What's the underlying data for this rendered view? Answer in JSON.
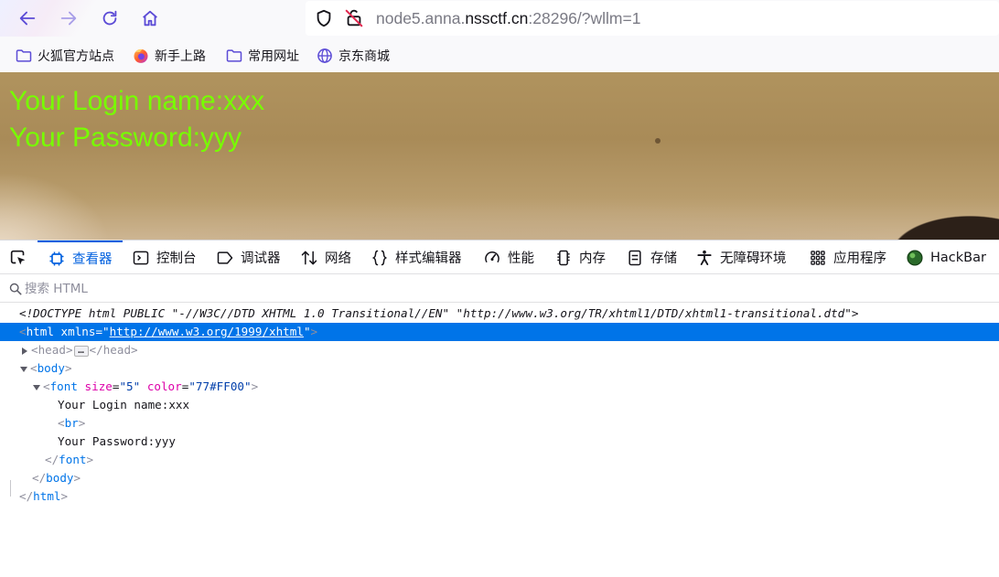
{
  "browser": {
    "url": {
      "prefix": "node5.anna.",
      "host": "nssctf.cn",
      "suffix": ":28296/?wllm=1"
    }
  },
  "bookmarks": [
    {
      "label": "火狐官方站点",
      "icon": "folder-icon"
    },
    {
      "label": "新手上路",
      "icon": "firefox-icon"
    },
    {
      "label": "常用网址",
      "icon": "folder-icon"
    },
    {
      "label": "京东商城",
      "icon": "globe-icon"
    }
  ],
  "page": {
    "login_line": "Your Login name:xxx",
    "password_line": "Your Password:yyy",
    "text_color": "#77ff00"
  },
  "devtools": {
    "tabs": [
      {
        "label": "查看器",
        "icon": "inspector-icon",
        "active": true
      },
      {
        "label": "控制台",
        "icon": "console-icon"
      },
      {
        "label": "调试器",
        "icon": "debugger-icon"
      },
      {
        "label": "网络",
        "icon": "network-icon"
      },
      {
        "label": "样式编辑器",
        "icon": "style-editor-icon"
      },
      {
        "label": "性能",
        "icon": "performance-icon"
      },
      {
        "label": "内存",
        "icon": "memory-icon"
      },
      {
        "label": "存储",
        "icon": "storage-icon"
      },
      {
        "label": "无障碍环境",
        "icon": "accessibility-icon"
      },
      {
        "label": "应用程序",
        "icon": "application-icon"
      },
      {
        "label": "HackBar",
        "icon": "hackbar-icon"
      }
    ],
    "search_placeholder": "搜索 HTML",
    "markup": {
      "doctype": "<!DOCTYPE html PUBLIC \"-//W3C//DTD XHTML 1.0 Transitional//EN\" \"http://www.w3.org/TR/xhtml1/DTD/xhtml1-transitional.dtd\">",
      "html_tag": "html",
      "html_attr": "xmlns",
      "html_attr_value": "http://www.w3.org/1999/xhtml",
      "head_tag": "head",
      "body_tag": "body",
      "font_tag": "font",
      "font_size_attr": "size",
      "font_size_value": "\"5\"",
      "font_color_attr": "color",
      "font_color_value": "\"77#FF00\"",
      "text_login": "Your Login name:xxx",
      "br_tag": "br",
      "text_password": "Your Password:yyy"
    }
  }
}
